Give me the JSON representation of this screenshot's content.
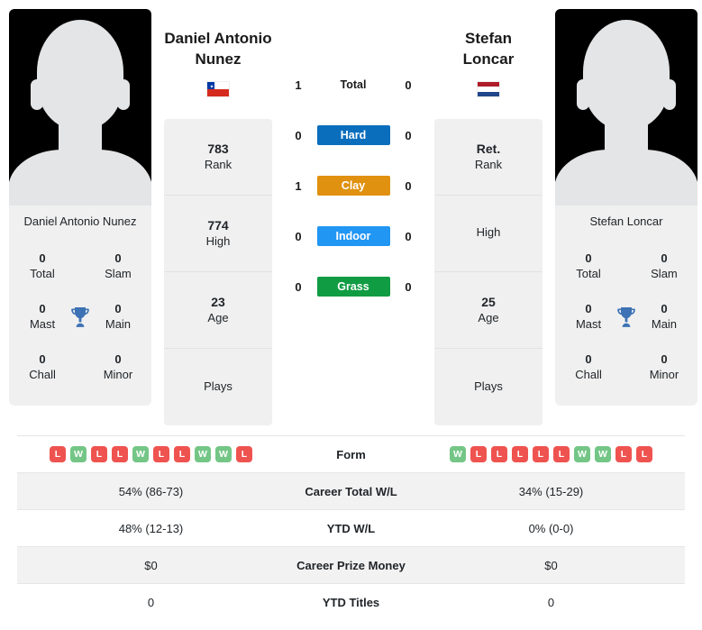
{
  "players": {
    "left": {
      "full_name": "Daniel Antonio Nunez",
      "name_line1": "Daniel Antonio",
      "name_line2": "Nunez",
      "flag": "chile-flag",
      "avatar_caption": "Daniel Antonio Nunez",
      "titles": {
        "total_value": "0",
        "total_label": "Total",
        "slam_value": "0",
        "slam_label": "Slam",
        "mast_value": "0",
        "mast_label": "Mast",
        "main_value": "0",
        "main_label": "Main",
        "chall_value": "0",
        "chall_label": "Chall",
        "minor_value": "0",
        "minor_label": "Minor"
      },
      "stats": [
        {
          "value": "783",
          "label": "Rank"
        },
        {
          "value": "774",
          "label": "High"
        },
        {
          "value": "23",
          "label": "Age"
        },
        {
          "value": "",
          "label": "Plays"
        }
      ],
      "surface_counts": {
        "total": "1",
        "hard": "0",
        "clay": "1",
        "indoor": "0",
        "grass": "0"
      },
      "form": [
        "L",
        "W",
        "L",
        "L",
        "W",
        "L",
        "L",
        "W",
        "W",
        "L"
      ],
      "career_total_wl": "54% (86-73)",
      "ytd_wl": "48% (12-13)",
      "career_prize_money": "$0",
      "ytd_titles": "0"
    },
    "right": {
      "full_name": "Stefan Loncar",
      "name_line1": "Stefan",
      "name_line2": "Loncar",
      "flag": "netherlands-flag",
      "avatar_caption": "Stefan Loncar",
      "titles": {
        "total_value": "0",
        "total_label": "Total",
        "slam_value": "0",
        "slam_label": "Slam",
        "mast_value": "0",
        "mast_label": "Mast",
        "main_value": "0",
        "main_label": "Main",
        "chall_value": "0",
        "chall_label": "Chall",
        "minor_value": "0",
        "minor_label": "Minor"
      },
      "stats": [
        {
          "value": "Ret.",
          "label": "Rank"
        },
        {
          "value": "",
          "label": "High"
        },
        {
          "value": "25",
          "label": "Age"
        },
        {
          "value": "",
          "label": "Plays"
        }
      ],
      "surface_counts": {
        "total": "0",
        "hard": "0",
        "clay": "0",
        "indoor": "0",
        "grass": "0"
      },
      "form": [
        "W",
        "L",
        "L",
        "L",
        "L",
        "L",
        "W",
        "W",
        "L",
        "L"
      ],
      "career_total_wl": "34% (15-29)",
      "ytd_wl": "0% (0-0)",
      "career_prize_money": "$0",
      "ytd_titles": "0"
    }
  },
  "surfaces": [
    {
      "key": "total",
      "label": "Total",
      "color": "",
      "is_header": true
    },
    {
      "key": "hard",
      "label": "Hard",
      "color": "#0a6ebd",
      "is_header": false
    },
    {
      "key": "clay",
      "label": "Clay",
      "color": "#e09110",
      "is_header": false
    },
    {
      "key": "indoor",
      "label": "Indoor",
      "color": "#2196f3",
      "is_header": false
    },
    {
      "key": "grass",
      "label": "Grass",
      "color": "#109c43",
      "is_header": false
    }
  ],
  "table": {
    "rows": [
      {
        "label": "Form",
        "type": "form"
      },
      {
        "label": "Career Total W/L",
        "type": "text",
        "key": "career_total_wl"
      },
      {
        "label": "YTD W/L",
        "type": "text",
        "key": "ytd_wl"
      },
      {
        "label": "Career Prize Money",
        "type": "text",
        "key": "career_prize_money"
      },
      {
        "label": "YTD Titles",
        "type": "text",
        "key": "ytd_titles"
      }
    ]
  },
  "icons": {
    "trophy": "trophy-icon",
    "trophy_color": "#3d72b4"
  }
}
